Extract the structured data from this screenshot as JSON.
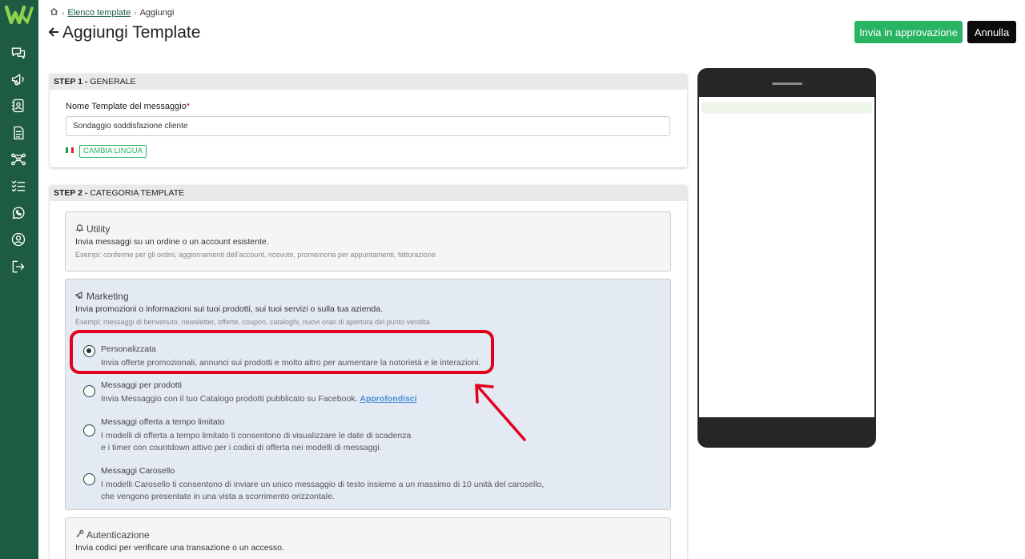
{
  "sidebar": {
    "logo": "W",
    "items": [
      "chat-icon",
      "megaphone-icon",
      "contacts-icon",
      "document-icon",
      "flow-icon",
      "checklist-icon",
      "whatsapp-icon",
      "user-icon",
      "logout-icon"
    ]
  },
  "breadcrumb": {
    "link": "Elenco template",
    "current": "Aggiungi"
  },
  "header": {
    "title": "Aggiungi Template",
    "approve_label": "Invia in approvazione",
    "cancel_label": "Annulla"
  },
  "step1": {
    "step_label": "STEP 1 -",
    "step_title": "GENERALE",
    "name_label": "Nome Template del messaggio",
    "required_mark": "*",
    "name_value": "Sondaggio soddisfazione cliente",
    "lang_button": "CAMBIA LINGUA"
  },
  "step2": {
    "step_label": "STEP 2 -",
    "step_title": "CATEGORIA TEMPLATE",
    "utility": {
      "title": "Utility",
      "desc": "Invia messaggi su un ordine o un account esistente.",
      "examples": "Esempi: conferme per gli ordini, aggiornamenti dell'account, ricevute, promemoria per appuntamenti, fatturazione"
    },
    "marketing": {
      "title": "Marketing",
      "desc": "Invia promozioni o informazioni sui tuoi prodotti, sui tuoi servizi o sulla tua azienda.",
      "examples": "Esempi: messaggi di benvenuto, newsletter, offerte, coupon, cataloghi, nuovi orari di apertura del punto vendita",
      "options": [
        {
          "title": "Personalizzata",
          "desc": "Invia offerte promozionali, annunci sui prodotti e molto altro per aumentare la notorietà e le interazioni."
        },
        {
          "title": "Messaggi per prodotti",
          "desc": "Invia Messaggio con il tuo Catalogo prodotti pubblicato su Facebook.",
          "link": "Approfondisci"
        },
        {
          "title": "Messaggi offerta a tempo limitato",
          "desc1": "I modelli di offerta a tempo limitato ti consentono di visualizzare le date di scadenza",
          "desc2": "e i timer con countdown attivo per i codici di offerta nei modelli di messaggi."
        },
        {
          "title": "Messaggi Carosello",
          "desc1": "I modelli Carosello ti consentono di inviare un unico messaggio di testo insieme a un massimo di 10 unità del carosello,",
          "desc2": "che vengono presentate in una vista a scorrimento orizzontale."
        }
      ]
    },
    "authentication": {
      "title": "Autenticazione",
      "desc": "Invia codici per verificare una transazione o un accesso."
    }
  },
  "colors": {
    "sidebar": "#1d5c43",
    "primary_button": "#29b463",
    "highlight": "#e3001b"
  }
}
